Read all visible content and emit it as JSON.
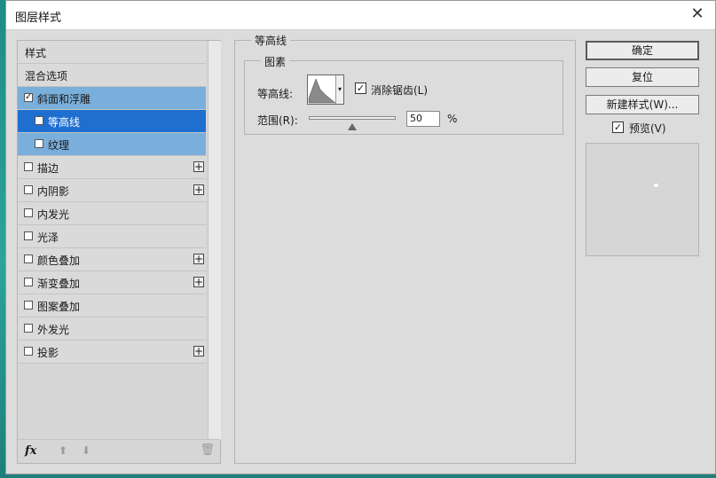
{
  "window": {
    "title": "图层样式",
    "close": "✕"
  },
  "left_panel": {
    "items": [
      {
        "label": "样式"
      },
      {
        "label": "混合选项"
      },
      {
        "label": "斜面和浮雕",
        "checked": true
      },
      {
        "label": "等高线",
        "checked": true
      },
      {
        "label": "纹理",
        "checked": false
      },
      {
        "label": "描边",
        "checked": false,
        "plus": "+"
      },
      {
        "label": "内阴影",
        "checked": false,
        "plus": "+"
      },
      {
        "label": "内发光",
        "checked": false
      },
      {
        "label": "光泽",
        "checked": false
      },
      {
        "label": "颜色叠加",
        "checked": false,
        "plus": "+"
      },
      {
        "label": "渐变叠加",
        "checked": false,
        "plus": "+"
      },
      {
        "label": "图案叠加",
        "checked": false
      },
      {
        "label": "外发光",
        "checked": false
      },
      {
        "label": "投影",
        "checked": false,
        "plus": "+"
      }
    ],
    "bottom": {
      "fx": "fx",
      "up": "⬆",
      "down": "⬇",
      "trash": "🗑"
    }
  },
  "center": {
    "group_title": "等高线",
    "sub_title": "图素",
    "contour_label": "等高线:",
    "antialias_label": "消除锯齿(L)",
    "antialias_checked": true,
    "range_label": "范围(R):",
    "range_value": "50",
    "range_unit": "%"
  },
  "right": {
    "ok": "确定",
    "reset": "复位",
    "new_style": "新建样式(W)...",
    "preview_label": "预览(V)",
    "preview_checked": true
  },
  "colors": {
    "selection": "#1f6fd0",
    "selection_light": "#7aaedb"
  }
}
